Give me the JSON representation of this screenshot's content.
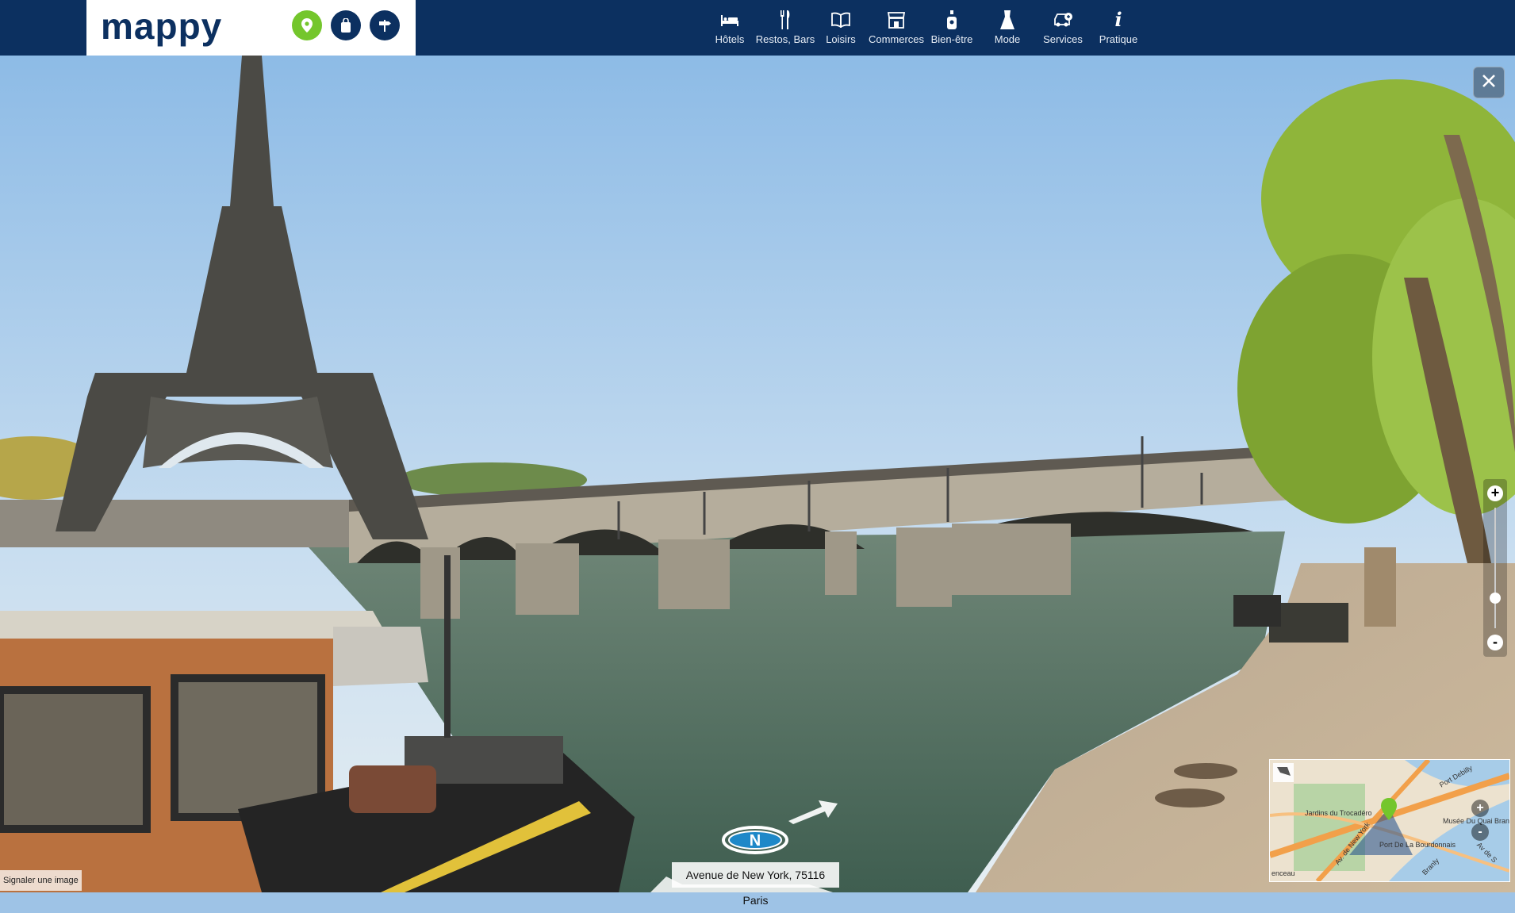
{
  "brand": {
    "logo_text": "mappy",
    "accent": "#74c62c",
    "navy": "#0c3060"
  },
  "top_actions": [
    {
      "name": "location-pin-icon",
      "color": "#74c62c"
    },
    {
      "name": "shopping-bag-icon",
      "color": "#0c3060"
    },
    {
      "name": "signpost-icon",
      "color": "#0c3060"
    }
  ],
  "nav": {
    "items": [
      {
        "label": "Hôtels",
        "icon": "bed-icon"
      },
      {
        "label": "Restos, Bars",
        "icon": "cutlery-icon"
      },
      {
        "label": "Loisirs",
        "icon": "book-icon"
      },
      {
        "label": "Commerces",
        "icon": "shop-icon"
      },
      {
        "label": "Bien-être",
        "icon": "bottle-icon"
      },
      {
        "label": "Mode",
        "icon": "dress-icon"
      },
      {
        "label": "Services",
        "icon": "car-service-icon"
      },
      {
        "label": "Pratique",
        "icon": "info-icon"
      }
    ]
  },
  "viewer": {
    "close_icon": "close-icon",
    "report_label": "Signaler une image",
    "address": "Avenue de New York, 75116 Paris",
    "compass_letter": "N",
    "zoom": {
      "in": "+",
      "out": "-",
      "level": 0.25
    }
  },
  "minimap": {
    "labels": [
      "Jardins du Trocadéro",
      "Musée Du Quai Bran",
      "Port De La Bourdonnais",
      "Av. de New York",
      "Port Debilly",
      "enceau",
      "Branly",
      "Av de S"
    ],
    "zoom_in": "+",
    "zoom_out": "-"
  }
}
